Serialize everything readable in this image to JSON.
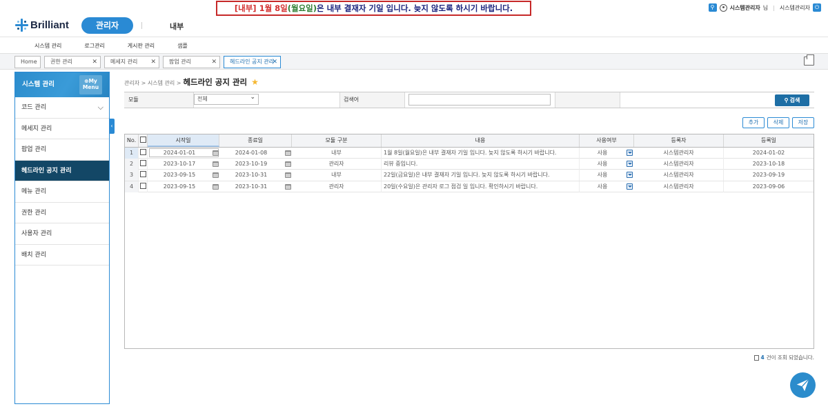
{
  "notice": {
    "part1": "[내부]",
    "part2": " 1월 8일",
    "part3": "(월요일)",
    "part4": "은 내부 결재자 기일 입니다. 늦지 않도록 하시기 바랍니다."
  },
  "user": {
    "name": "시스템관리자",
    "suffix": "님",
    "role": "시스템관리자"
  },
  "brand": {
    "logo": "Brilliant",
    "admin_tab": "관리자",
    "inner_tab": "내부"
  },
  "subnav": [
    "시스템 관리",
    "로그관리",
    "게시판 관리",
    "샘플"
  ],
  "tabs": [
    {
      "label": "Home",
      "closable": false
    },
    {
      "label": "권한 관리",
      "closable": true
    },
    {
      "label": "메세지 관리",
      "closable": true
    },
    {
      "label": "팝업 관리",
      "closable": true
    },
    {
      "label": "헤드라인 공지 관리",
      "closable": true,
      "active": true
    }
  ],
  "sidebar": {
    "title": "시스템 관리",
    "mymenu_top": "⊕My",
    "mymenu_bottom": "Menu",
    "items": [
      {
        "label": "코드 관리",
        "expandable": true
      },
      {
        "label": "메세지 관리"
      },
      {
        "label": "팝업 관리"
      },
      {
        "label": "헤드라인 공지 관리",
        "active": true
      },
      {
        "label": "메뉴 관리"
      },
      {
        "label": "권한 관리"
      },
      {
        "label": "사용자 관리"
      },
      {
        "label": "배치 관리"
      }
    ]
  },
  "breadcrumb": {
    "path": "관리자 > 시스템 관리 >",
    "title": "헤드라인 공지 관리"
  },
  "search": {
    "module_label": "모듈",
    "module_value": "전체",
    "keyword_label": "검색어",
    "keyword_value": "",
    "search_button": "검색"
  },
  "actions": {
    "add": "추가",
    "delete": "삭제",
    "save": "저장"
  },
  "grid": {
    "columns": [
      "No.",
      "",
      "시작일",
      "종료일",
      "모듈 구분",
      "내용",
      "사용여부",
      "등록자",
      "등록일"
    ],
    "rows": [
      {
        "no": "1",
        "start": "2024-01-01",
        "end": "2024-01-08",
        "module": "내부",
        "content": "1월 8일(월요일)은 내부 결재자 기일 입니다. 늦지 않도록 하시기 바랍니다.",
        "use": "사용",
        "writer": "시스템관리자",
        "date": "2024-01-02"
      },
      {
        "no": "2",
        "start": "2023-10-17",
        "end": "2023-10-19",
        "module": "관리자",
        "content": "리뷰 중입니다.",
        "use": "사용",
        "writer": "시스템관리자",
        "date": "2023-10-18"
      },
      {
        "no": "3",
        "start": "2023-09-15",
        "end": "2023-10-31",
        "module": "내부",
        "content": "22일(금요일)은 내부 결재자 기일 입니다. 늦지 않도록 하시기 바랍니다.",
        "use": "사용",
        "writer": "시스템관리자",
        "date": "2023-09-19"
      },
      {
        "no": "4",
        "start": "2023-09-15",
        "end": "2023-10-31",
        "module": "관리자",
        "content": "20일(수요일)은 관리자 로그 점검 일 입니다. 확인하시기 바랍니다.",
        "use": "사용",
        "writer": "시스템관리자",
        "date": "2023-09-06"
      }
    ]
  },
  "footer": {
    "count": "4",
    "count_suffix": "건이 조회 되었습니다."
  },
  "colors": {
    "accent": "#2a8ad4",
    "sidebar_active": "#134766",
    "notice_border": "#c62828"
  }
}
